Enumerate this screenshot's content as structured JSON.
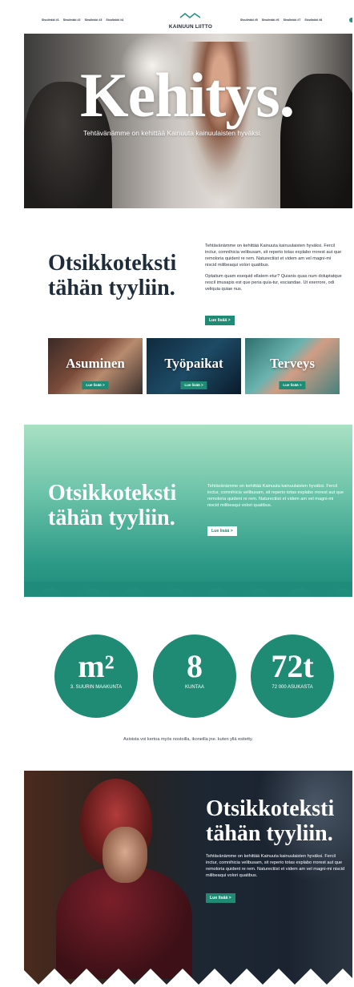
{
  "nav": {
    "left": [
      "Sivulinkki #1",
      "Sivulinkki #2",
      "Sivulinkki #3",
      "Sivulinkki #4"
    ],
    "right": [
      "Sivulinkki #5",
      "Sivulinkki #6",
      "Sivulinkki #7",
      "Sivulinkki #8"
    ],
    "logo_text": "KAINUUN LIITTO"
  },
  "hero": {
    "title": "Kehitys.",
    "subtitle": "Tehtävänämme on kehittää Kainuuta kainuulaisten hyväksi."
  },
  "intro": {
    "title": "Otsikkoteksti tähän tyyliin.",
    "paragraph1": "Tehtävänämme on kehittää Kainuuta kainuulaisten hyväksi. Fercil inctur, comnihicia velibusam, sit reperio totas explabo rrorest aut que remoloria quident re rem. Naturectiist et videm am vel magni-mi niscid milibeaqui volori quatibus.",
    "paragraph2": "Optatium quam esequid ellatem etur? Quianis quas num doluptatque rescil imusapis est que peria quia-tur, esciandae. Ut exerrore, odi veliquia quiae nus.",
    "button": "Lue lisää >"
  },
  "tiles": [
    {
      "label": "Asuminen",
      "button": "Lue lisää >"
    },
    {
      "label": "Työpaikat",
      "button": "Lue lisää >"
    },
    {
      "label": "Terveys",
      "button": "Lue lisää >"
    }
  ],
  "band": {
    "title": "Otsikkoteksti tähän tyyliin.",
    "text": "Tehtävänämme on kehittää Kainuuta kainuulaisten hyväksi. Fercil inctur, comnihicia velibusam, sit reperio totas explabo rrorest aut que remoloria quident re rem. Naturectiist et videm am vel magni-mi niscid milibeaqui volori quatibus.",
    "button": "Lue lisää >"
  },
  "stats": [
    {
      "big": "m²",
      "small": "3. SUURIN MAAKUNTA"
    },
    {
      "big": "8",
      "small": "KUNTAA"
    },
    {
      "big": "72t",
      "small": "72 000 ASUKASTA"
    }
  ],
  "stats_note": "Asioista voi kertoa myös nostoilla, ikoneilla jne. kuten yllä esitetty.",
  "welder": {
    "title": "Otsikkoteksti tähän tyyliin.",
    "text": "Tehtävänämme on kehittää Kainuuta kainuulaisten hyväksi. Fercil inctur, comnihicia velibusam, sit reperio totas explabo rrorest aut que remoloria quident re rem. Naturectiist et videm am vel magni-mi niscid milibeaqui volori quatibus.",
    "button": "Lue lisää >"
  },
  "colors": {
    "accent": "#1f8b74",
    "dark_text": "#1f2d3b",
    "mint": "#a9e0c4"
  }
}
